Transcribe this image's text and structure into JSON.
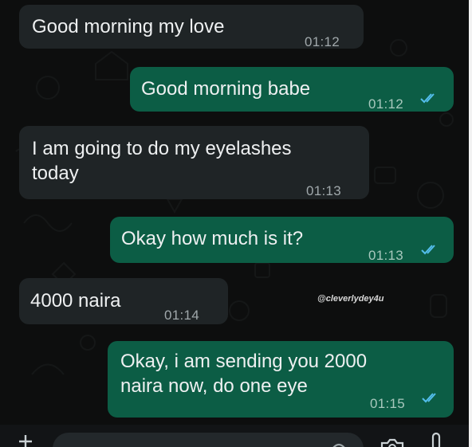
{
  "messages": [
    {
      "direction": "incoming",
      "text": "Good morning my love",
      "time": "01:12"
    },
    {
      "direction": "outgoing",
      "text": "Good morning babe",
      "time": "01:12",
      "status": "read"
    },
    {
      "direction": "incoming",
      "text": "I am going to do my eyelashes\ntoday",
      "time": "01:13"
    },
    {
      "direction": "outgoing",
      "text": "Okay how much is it?",
      "time": "01:13",
      "status": "read"
    },
    {
      "direction": "incoming",
      "text": "4000 naira",
      "time": "01:14"
    },
    {
      "direction": "outgoing",
      "text": "Okay, i am sending you 2000\nnaira now, do one eye",
      "time": "01:15",
      "status": "read"
    }
  ],
  "watermark": "@cleverlydey4u",
  "colors": {
    "background": "#0d0e0e",
    "incoming_bubble": "#1f2426",
    "outgoing_bubble": "#0c5d45",
    "read_ticks": "#53bdeb"
  },
  "composer": {
    "icons": [
      "plus-icon",
      "sticker-icon",
      "camera-icon",
      "microphone-icon"
    ]
  }
}
